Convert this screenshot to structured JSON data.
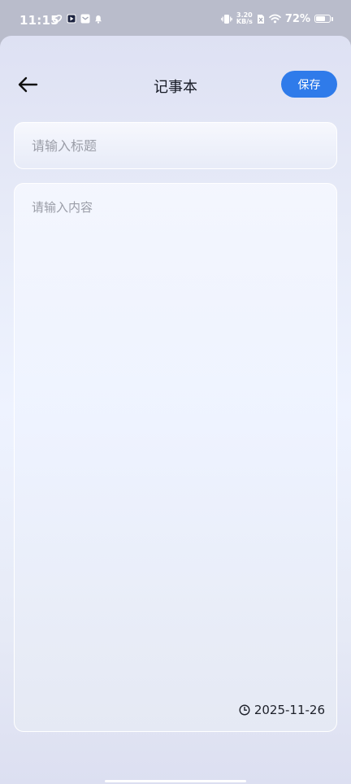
{
  "status_bar": {
    "time": "11:15",
    "net_speed_value": "3.20",
    "net_speed_unit": "KB/s",
    "battery_percent": "72%",
    "battery_level": 0.72,
    "icons": [
      "orbit-icon",
      "play-app-icon",
      "mail-icon",
      "bell-icon",
      "vibrate-icon",
      "sim-off-icon",
      "wifi-icon",
      "battery-icon"
    ]
  },
  "header": {
    "title": "记事本",
    "save_label": "保存",
    "back_icon": "arrow-left-icon"
  },
  "editor": {
    "title_placeholder": "请输入标题",
    "content_placeholder": "请输入内容",
    "date": "2025-11-26",
    "date_icon": "clock-icon"
  },
  "colors": {
    "accent": "#2f7bea",
    "title_text": "#161a25",
    "placeholder": "#9a9da7"
  }
}
